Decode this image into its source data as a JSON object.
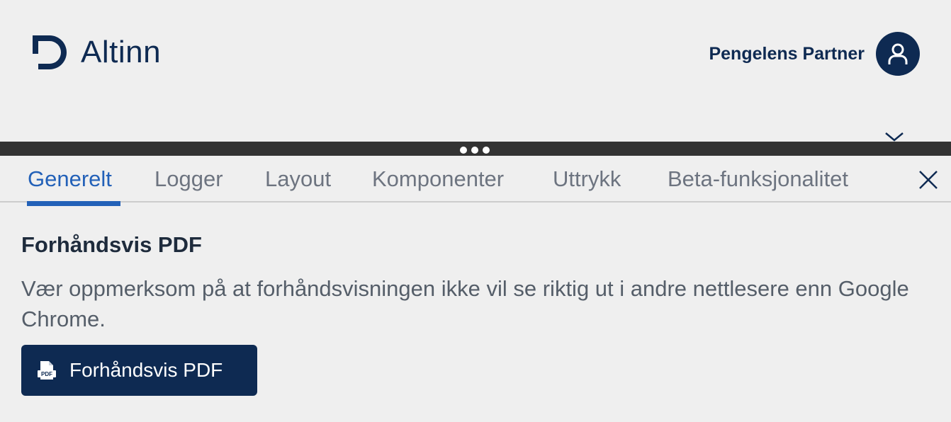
{
  "header": {
    "logo_text": "Altinn",
    "user_name": "Pengelens Partner"
  },
  "devtools": {
    "tabs": [
      {
        "label": "Generelt",
        "active": true
      },
      {
        "label": "Logger",
        "active": false
      },
      {
        "label": "Layout",
        "active": false
      },
      {
        "label": "Komponenter",
        "active": false
      },
      {
        "label": "Uttrykk",
        "active": false
      },
      {
        "label": "Beta-funksjonalitet",
        "active": false
      }
    ],
    "section_title": "Forhåndsvis PDF",
    "section_description": "Vær oppmerksom på at forhåndsvisningen ikke vil se riktig ut i andre nettlesere enn Google Chrome.",
    "pdf_button_label": "Forhåndsvis PDF",
    "pdf_icon_text": "PDF"
  },
  "icons": {
    "logo": "altinn-logo-icon",
    "avatar": "user-icon",
    "close": "close-icon",
    "pdf": "file-pdf-icon",
    "chevron": "chevron-down-icon"
  },
  "colors": {
    "brand_dark": "#0e2a52",
    "accent_blue": "#2361b8",
    "background": "#efefef",
    "drag_bar": "#333333"
  }
}
